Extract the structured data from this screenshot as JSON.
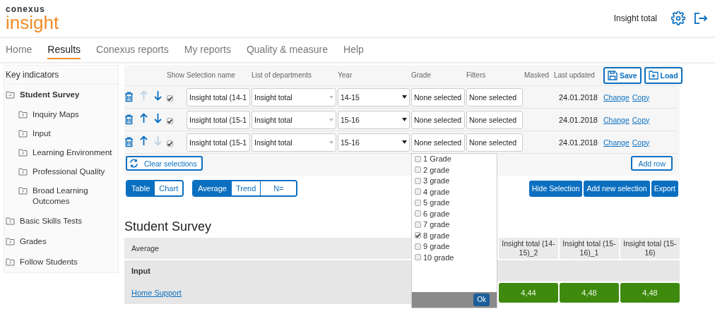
{
  "header": {
    "logo_top": "conexus",
    "logo": "insight",
    "user": "Insight total"
  },
  "nav": [
    {
      "label": "Home",
      "selected": false
    },
    {
      "label": "Results",
      "selected": true
    },
    {
      "label": "Conexus reports",
      "selected": false
    },
    {
      "label": "My reports",
      "selected": false
    },
    {
      "label": "Quality & measure",
      "selected": false
    },
    {
      "label": "Help",
      "selected": false
    }
  ],
  "sidebar": {
    "title": "Key indicators",
    "items": [
      {
        "label": "Student Survey",
        "expanded": true,
        "children": [
          {
            "label": "Inquiry Maps",
            "expanded": false
          },
          {
            "label": "Input",
            "expanded": false
          },
          {
            "label": "Learning Environment",
            "expanded": false
          },
          {
            "label": "Professional Quality",
            "expanded": false
          },
          {
            "label": "Broad Learning Outcomes",
            "expanded": false
          }
        ]
      },
      {
        "label": "Basic Skills Tests",
        "expanded": false
      },
      {
        "label": "Grades",
        "expanded": false
      },
      {
        "label": "Follow Students",
        "expanded": false
      }
    ]
  },
  "selections": {
    "columns": [
      "Show",
      "Selection name",
      "List of departments",
      "Year",
      "Grade",
      "Filters",
      "Masked",
      "Last updated"
    ],
    "save": "Save",
    "load": "Load",
    "rows": [
      {
        "show": true,
        "up_enabled": false,
        "down_enabled": true,
        "name": "Insight total (14-1",
        "department": "Insight total",
        "year": "14-15",
        "grade": "None selected",
        "filters": "None selected",
        "last_updated": "24.01.2018",
        "links": [
          "Change",
          "Copy"
        ]
      },
      {
        "show": true,
        "up_enabled": true,
        "down_enabled": true,
        "name": "Insight total (15-1",
        "department": "Insight total",
        "year": "15-16",
        "grade": "None selected",
        "filters": "None selected",
        "last_updated": "24.01.2018",
        "links": [
          "Change",
          "Copy"
        ]
      },
      {
        "show": true,
        "up_enabled": true,
        "down_enabled": false,
        "name": "Insight total (15-1",
        "department": "Insight total",
        "year": "15-16",
        "grade": "None selected",
        "filters": "None selected",
        "last_updated": "24.01.2018",
        "links": [
          "Change",
          "Copy"
        ]
      }
    ],
    "clear": "Clear selections",
    "add_row": "Add row"
  },
  "grade_dropdown": {
    "ok": "Ok",
    "options": [
      {
        "label": "1 Grade",
        "checked": false
      },
      {
        "label": "2 grade",
        "checked": false
      },
      {
        "label": "3 grade",
        "checked": false
      },
      {
        "label": "4 grade",
        "checked": false
      },
      {
        "label": "5 grade",
        "checked": false
      },
      {
        "label": "6 grade",
        "checked": false
      },
      {
        "label": "7 grade",
        "checked": false
      },
      {
        "label": "8 grade",
        "checked": true
      },
      {
        "label": "9 grade",
        "checked": false
      },
      {
        "label": "10 grade",
        "checked": false
      }
    ]
  },
  "view_toggle": [
    {
      "label": "Table",
      "selected": true
    },
    {
      "label": "Chart",
      "selected": false
    }
  ],
  "measure_toggle": [
    {
      "label": "Average",
      "selected": true
    },
    {
      "label": "Trend",
      "selected": false
    },
    {
      "label": "N=",
      "selected": false
    }
  ],
  "actions": [
    "Hide Selection",
    "Add new selection",
    "Export"
  ],
  "results": {
    "title": "Student Survey",
    "header_label": "Average",
    "columns": [
      "Insight total (14-15)_2",
      "Insight total (15-16)_1",
      "Insight total (15-16)"
    ],
    "rows": [
      {
        "kind": "section",
        "label": "Input"
      },
      {
        "kind": "item",
        "label": "Home Support",
        "values": [
          "4,44",
          "4,48",
          "4,48"
        ]
      }
    ]
  }
}
